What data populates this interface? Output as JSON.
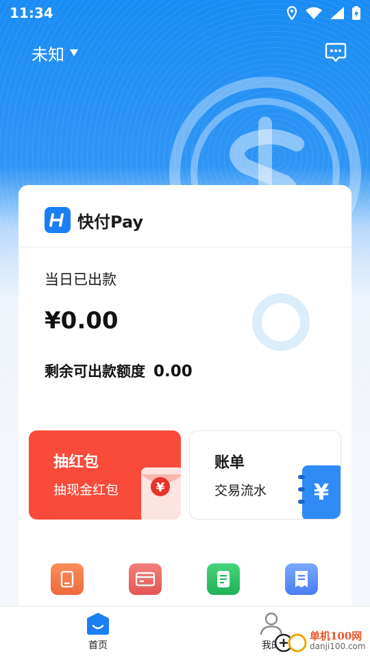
{
  "status_bar": {
    "time": "11:34"
  },
  "header": {
    "location": "未知"
  },
  "brand": {
    "name": "快付Pay"
  },
  "summary": {
    "today_label": "当日已出款",
    "today_amount": "¥0.00",
    "quota_label": "剩余可出款额度",
    "quota_value": "0.00"
  },
  "tiles": [
    {
      "title": "抽红包",
      "subtitle": "抽现金红包",
      "art_symbol": "¥"
    },
    {
      "title": "账单",
      "subtitle": "交易流水",
      "art_symbol": "¥"
    }
  ],
  "quick_actions": [
    {
      "icon": "tablet-icon",
      "color": "#f07040"
    },
    {
      "icon": "card-icon",
      "color": "#e85a58"
    },
    {
      "icon": "document-icon",
      "color": "#25b85e"
    },
    {
      "icon": "receipt-icon",
      "color": "#5585f5"
    }
  ],
  "tabbar": {
    "tabs": [
      {
        "label": "首页",
        "active": true
      },
      {
        "label": "我的",
        "active": false
      }
    ]
  },
  "watermark": {
    "name": "单机100网",
    "url": "danji100.com"
  },
  "colors": {
    "primary": "#1a7ff3",
    "red": "#f94a3a",
    "hero_blue": "#1a8cf5"
  }
}
